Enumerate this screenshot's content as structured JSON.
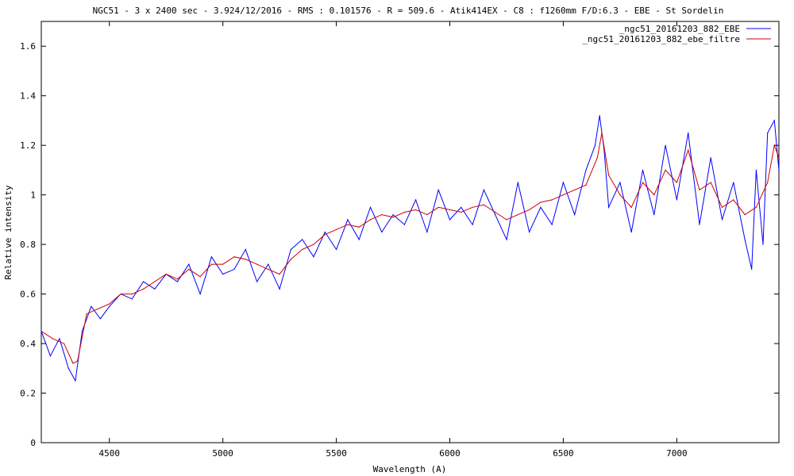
{
  "chart_data": {
    "type": "line",
    "title": "NGC51 - 3 x 2400 sec - 3.924/12/2016 - RMS : 0.101576 - R = 509.6 - Atik414EX - C8 : f1260mm F/D:6.3 - EBE - St Sordelin",
    "xlabel": "Wavelength (A)",
    "ylabel": "Relative intensity",
    "xlim": [
      4200,
      7450
    ],
    "ylim": [
      0,
      1.7
    ],
    "xticks": [
      4500,
      5000,
      5500,
      6000,
      6500,
      7000
    ],
    "yticks": [
      0,
      0.2,
      0.4,
      0.6,
      0.8,
      1,
      1.2,
      1.4,
      1.6
    ],
    "ytick_labels": [
      "0",
      "0.2",
      "0.4",
      "0.6",
      "0.8",
      "1",
      "1.2",
      "1.4",
      "1.6"
    ],
    "grid": false,
    "legend_position": "top-right",
    "series": [
      {
        "name": "_ngc51_20161203_882_EBE",
        "color": "#0000ff",
        "x": [
          4200,
          4240,
          4280,
          4320,
          4350,
          4380,
          4420,
          4460,
          4500,
          4550,
          4600,
          4650,
          4700,
          4750,
          4800,
          4850,
          4900,
          4950,
          5000,
          5050,
          5100,
          5150,
          5200,
          5250,
          5300,
          5350,
          5400,
          5450,
          5500,
          5550,
          5600,
          5650,
          5700,
          5750,
          5800,
          5850,
          5900,
          5950,
          6000,
          6050,
          6100,
          6150,
          6200,
          6250,
          6300,
          6350,
          6400,
          6450,
          6500,
          6550,
          6600,
          6640,
          6660,
          6680,
          6700,
          6750,
          6800,
          6850,
          6900,
          6950,
          7000,
          7050,
          7100,
          7150,
          7200,
          7250,
          7300,
          7330,
          7350,
          7380,
          7400,
          7430,
          7450
        ],
        "y": [
          0.45,
          0.35,
          0.42,
          0.3,
          0.25,
          0.45,
          0.55,
          0.5,
          0.55,
          0.6,
          0.58,
          0.65,
          0.62,
          0.68,
          0.65,
          0.72,
          0.6,
          0.75,
          0.68,
          0.7,
          0.78,
          0.65,
          0.72,
          0.62,
          0.78,
          0.82,
          0.75,
          0.85,
          0.78,
          0.9,
          0.82,
          0.95,
          0.85,
          0.92,
          0.88,
          0.98,
          0.85,
          1.02,
          0.9,
          0.95,
          0.88,
          1.02,
          0.92,
          0.82,
          1.05,
          0.85,
          0.95,
          0.88,
          1.05,
          0.92,
          1.1,
          1.2,
          1.32,
          1.18,
          0.95,
          1.05,
          0.85,
          1.1,
          0.92,
          1.2,
          0.98,
          1.25,
          0.88,
          1.15,
          0.9,
          1.05,
          0.82,
          0.7,
          1.1,
          0.8,
          1.25,
          1.3,
          1.1
        ]
      },
      {
        "name": "_ngc51_20161203_882_ebe_filtre",
        "color": "#cc0000",
        "x": [
          4200,
          4250,
          4300,
          4340,
          4360,
          4400,
          4450,
          4500,
          4550,
          4600,
          4650,
          4700,
          4750,
          4800,
          4850,
          4900,
          4950,
          5000,
          5050,
          5100,
          5150,
          5200,
          5250,
          5300,
          5350,
          5400,
          5450,
          5500,
          5550,
          5600,
          5650,
          5700,
          5750,
          5800,
          5850,
          5900,
          5950,
          6000,
          6050,
          6100,
          6150,
          6200,
          6250,
          6300,
          6350,
          6400,
          6450,
          6500,
          6550,
          6600,
          6650,
          6670,
          6700,
          6750,
          6800,
          6850,
          6900,
          6950,
          7000,
          7050,
          7100,
          7150,
          7200,
          7250,
          7300,
          7350,
          7400,
          7430,
          7450
        ],
        "y": [
          0.45,
          0.42,
          0.4,
          0.32,
          0.33,
          0.52,
          0.54,
          0.56,
          0.6,
          0.6,
          0.62,
          0.65,
          0.68,
          0.66,
          0.7,
          0.67,
          0.72,
          0.72,
          0.75,
          0.74,
          0.72,
          0.7,
          0.68,
          0.74,
          0.78,
          0.8,
          0.84,
          0.86,
          0.88,
          0.87,
          0.9,
          0.92,
          0.91,
          0.93,
          0.94,
          0.92,
          0.95,
          0.94,
          0.93,
          0.95,
          0.96,
          0.93,
          0.9,
          0.92,
          0.94,
          0.97,
          0.98,
          1.0,
          1.02,
          1.04,
          1.15,
          1.25,
          1.08,
          1.0,
          0.95,
          1.05,
          1.0,
          1.1,
          1.05,
          1.18,
          1.02,
          1.05,
          0.95,
          0.98,
          0.92,
          0.95,
          1.05,
          1.2,
          1.15
        ]
      }
    ]
  }
}
